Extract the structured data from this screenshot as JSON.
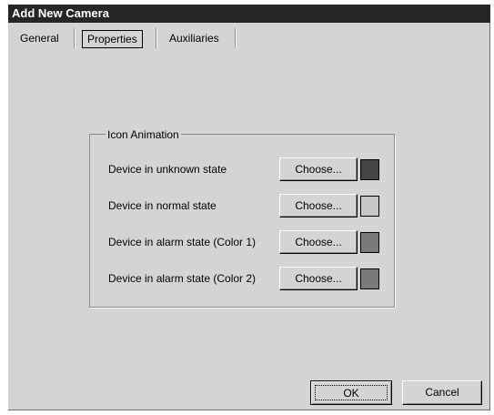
{
  "window": {
    "title": "Add New Camera"
  },
  "tabs": [
    {
      "label": "General",
      "active": false
    },
    {
      "label": "Properties",
      "active": true
    },
    {
      "label": "Auxiliaries",
      "active": false
    }
  ],
  "icon_animation": {
    "title": "Icon Animation",
    "rows": [
      {
        "label": "Device in unknown state",
        "button": "Choose...",
        "color": "#444444"
      },
      {
        "label": "Device in normal state",
        "button": "Choose...",
        "color": "#c8c8c8"
      },
      {
        "label": "Device in alarm state (Color 1)",
        "button": "Choose...",
        "color": "#7a7a7a"
      },
      {
        "label": "Device in alarm state (Color 2)",
        "button": "Choose...",
        "color": "#7a7a7a"
      }
    ]
  },
  "footer": {
    "ok_label": "OK",
    "cancel_label": "Cancel"
  }
}
